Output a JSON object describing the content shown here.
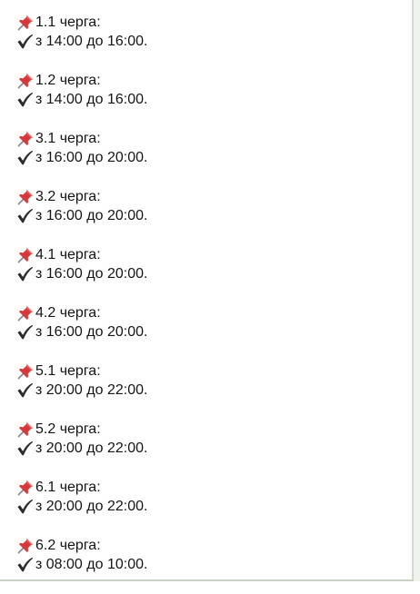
{
  "icons": {
    "pin": "pushpin-icon",
    "check": "check-mark-icon",
    "pin_color": "#d9383a",
    "check_color": "#2b2b2b"
  },
  "schedule": [
    {
      "queue": "1.1 черга:",
      "time": "з 14:00 до 16:00."
    },
    {
      "queue": "1.2 черга:",
      "time": "з 14:00 до 16:00."
    },
    {
      "queue": "3.1 черга:",
      "time": "з 16:00 до 20:00."
    },
    {
      "queue": "3.2 черга:",
      "time": "з 16:00 до 20:00."
    },
    {
      "queue": "4.1 черга:",
      "time": "з 16:00 до 20:00."
    },
    {
      "queue": "4.2 черга:",
      "time": "з 16:00 до 20:00."
    },
    {
      "queue": "5.1 черга:",
      "time": "з 20:00 до 22:00."
    },
    {
      "queue": "5.2 черга:",
      "time": "з 20:00 до 22:00."
    },
    {
      "queue": "6.1 черга:",
      "time": "з 20:00 до 22:00."
    },
    {
      "queue": "6.2 черга:",
      "time": "з 08:00 до 10:00."
    }
  ]
}
